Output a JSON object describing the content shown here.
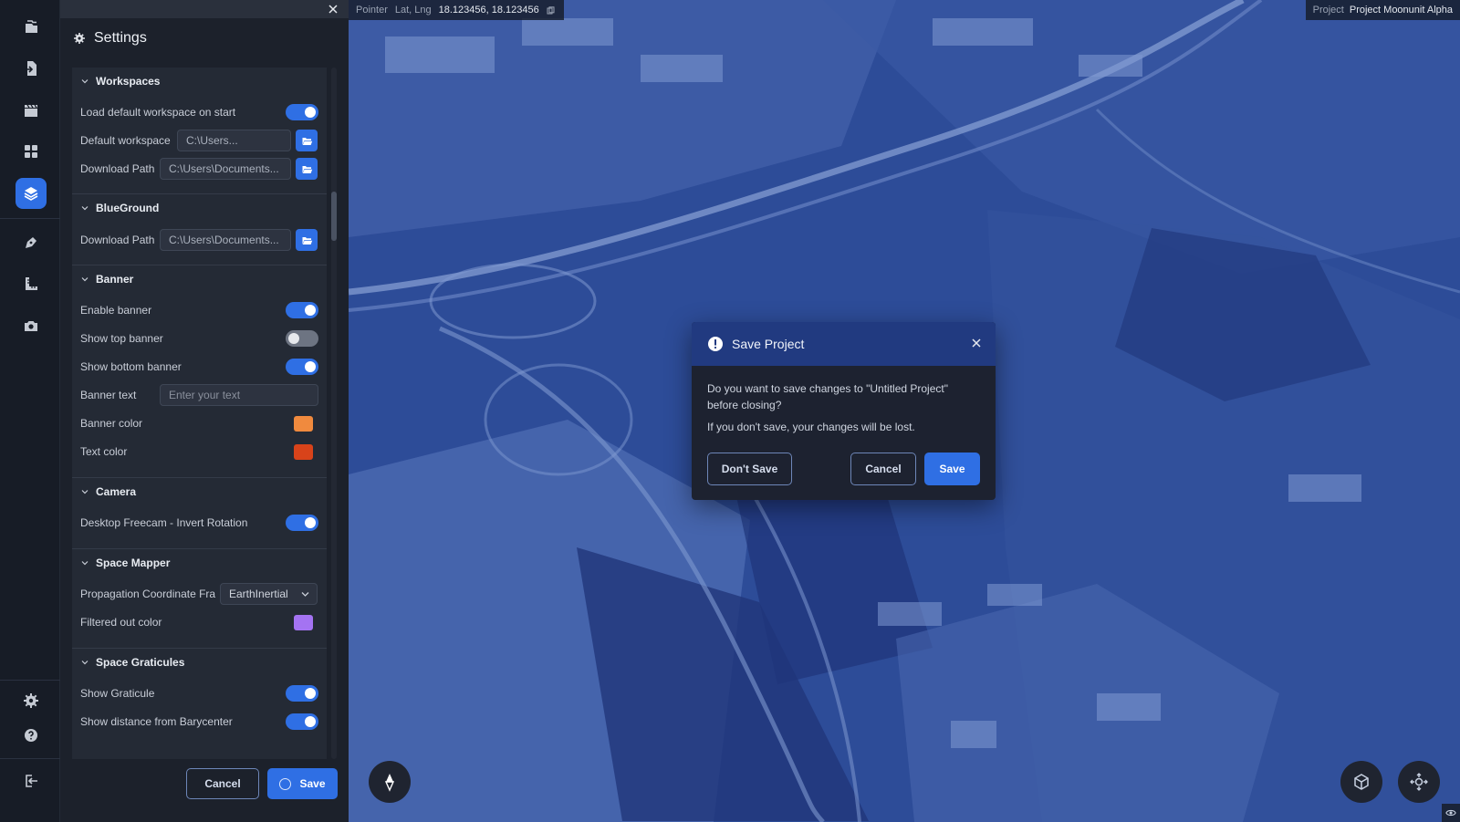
{
  "settings": {
    "title": "Settings",
    "sections": {
      "workspaces": {
        "title": "Workspaces",
        "load_default_label": "Load default workspace on start",
        "load_default_on": true,
        "default_workspace_label": "Default workspace",
        "default_workspace_value": "C:\\Users...",
        "download_path_label": "Download Path",
        "download_path_value": "C:\\Users\\Documents..."
      },
      "blueground": {
        "title": "BlueGround",
        "download_path_label": "Download Path",
        "download_path_value": "C:\\Users\\Documents..."
      },
      "banner": {
        "title": "Banner",
        "enable_label": "Enable banner",
        "enable_on": true,
        "top_label": "Show top banner",
        "top_on": false,
        "bottom_label": "Show bottom banner",
        "bottom_on": true,
        "text_label": "Banner text",
        "text_placeholder": "Enter your text",
        "color_label": "Banner color",
        "color_value": "#f08a3e",
        "text_color_label": "Text color",
        "text_color_value": "#d8431a"
      },
      "camera": {
        "title": "Camera",
        "freecam_label": "Desktop Freecam - Invert Rotation",
        "freecam_on": true
      },
      "space_mapper": {
        "title": "Space Mapper",
        "propagation_label": "Propagation Coordinate Fra",
        "propagation_value": "EarthInertial",
        "filtered_label": "Filtered out color",
        "filtered_color": "#a473f2"
      },
      "graticules": {
        "title": "Space Graticules",
        "show_label": "Show Graticule",
        "show_on": true,
        "barycenter_label": "Show distance from Barycenter",
        "barycenter_on": true
      }
    },
    "footer": {
      "cancel_label": "Cancel",
      "save_label": "Save"
    }
  },
  "map": {
    "pointer_label": "Pointer",
    "latlng_label": "Lat, Lng",
    "latlng_value": "18.123456, 18.123456",
    "project_label": "Project",
    "project_value": "Project Moonunit Alpha"
  },
  "dialog": {
    "title": "Save Project",
    "message": "Do you want to save changes to \"Untitled Project\" before closing?",
    "note": "If you don't save, your changes will be lost.",
    "dont_save_label": "Don't Save",
    "cancel_label": "Cancel",
    "save_label": "Save"
  },
  "colors": {
    "accent": "#2f6fe4",
    "panel_bg": "#1c212b",
    "dialog_header": "#213a80"
  },
  "icons": {
    "rail": [
      "folder-stack-icon",
      "file-import-icon",
      "clapperboard-icon",
      "dashboard-grid-icon",
      "layers-icon",
      "pen-nib-icon",
      "ruler-icon",
      "camera-icon",
      "gear-icon",
      "help-icon",
      "logout-icon"
    ],
    "map": [
      "compass-icon",
      "cube-view-icon",
      "orbit-icon",
      "eye-icon"
    ]
  }
}
